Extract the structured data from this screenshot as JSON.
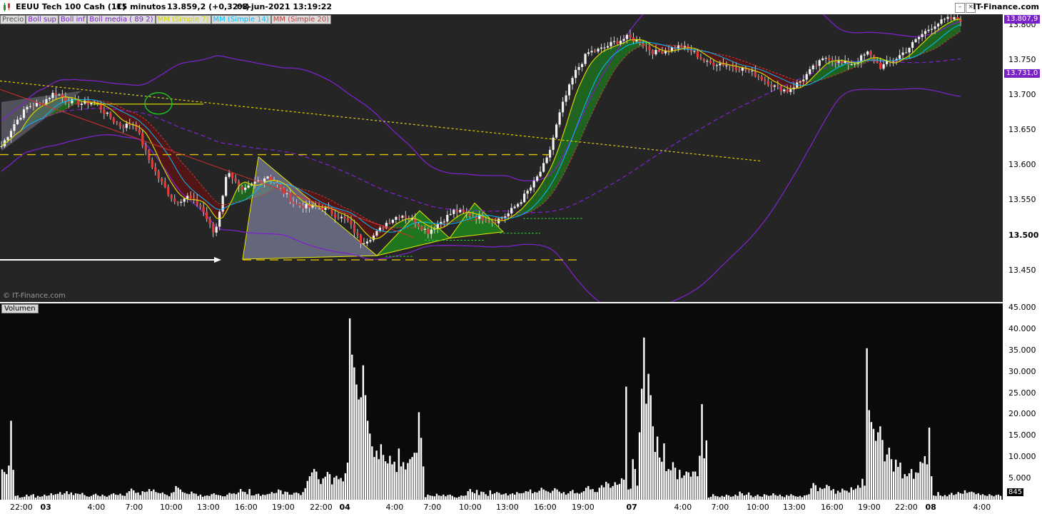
{
  "header": {
    "instrument": "EEUU Tech 100 Cash (1€)",
    "timeframe": "15 minutos",
    "price": "13.859,2 (+0,32%)",
    "datetime": "08-jun-2021 13:19:22",
    "brand": "IT-Finance.com"
  },
  "legend": [
    {
      "label": "Precio",
      "color": "#555555"
    },
    {
      "label": "Boll sup",
      "color": "#7b22c7"
    },
    {
      "label": "Boll inf",
      "color": "#7b22c7"
    },
    {
      "label": "Boll media ( 89 2)",
      "color": "#7b22c7"
    },
    {
      "label": "MM (Simple 7)",
      "color": "#d6d600"
    },
    {
      "label": "MM (Simple 14)",
      "color": "#00bfff"
    },
    {
      "label": "MM (Simple 20)",
      "color": "#c04040"
    }
  ],
  "watermark": "© IT-Finance.com",
  "volume_label": "Volumen",
  "volume_current": "845",
  "price_tags": [
    {
      "value": "13.807,9",
      "color": "#7b22c7"
    },
    {
      "value": "13.731,0",
      "color": "#7b22c7"
    }
  ],
  "chart_data": [
    {
      "type": "candlestick",
      "title": "EEUU Tech 100 Cash (1€)",
      "xlabel": "",
      "ylabel": "",
      "ylim": [
        13405,
        13815
      ],
      "y_ticks": [
        "13.450",
        "13.500",
        "13.550",
        "13.600",
        "13.650",
        "13.700",
        "13.750",
        "13.800"
      ],
      "x_ticks": [
        {
          "label": "22:00",
          "bold": false
        },
        {
          "label": "03",
          "bold": true
        },
        {
          "label": "4:00",
          "bold": false
        },
        {
          "label": "7:00",
          "bold": false
        },
        {
          "label": "10:00",
          "bold": false
        },
        {
          "label": "13:00",
          "bold": false
        },
        {
          "label": "16:00",
          "bold": false
        },
        {
          "label": "19:00",
          "bold": false
        },
        {
          "label": "22:00",
          "bold": false
        },
        {
          "label": "04",
          "bold": true
        },
        {
          "label": "4:00",
          "bold": false
        },
        {
          "label": "7:00",
          "bold": false
        },
        {
          "label": "10:00",
          "bold": false
        },
        {
          "label": "13:00",
          "bold": false
        },
        {
          "label": "16:00",
          "bold": false
        },
        {
          "label": "19:00",
          "bold": false
        },
        {
          "label": "07",
          "bold": true
        },
        {
          "label": "4:00",
          "bold": false
        },
        {
          "label": "7:00",
          "bold": false
        },
        {
          "label": "10:00",
          "bold": false
        },
        {
          "label": "13:00",
          "bold": false
        },
        {
          "label": "16:00",
          "bold": false
        },
        {
          "label": "19:00",
          "bold": false
        },
        {
          "label": "22:00",
          "bold": false
        },
        {
          "label": "08",
          "bold": true
        },
        {
          "label": "4:00",
          "bold": false
        }
      ],
      "close_path": [
        13627,
        13660,
        13684,
        13688,
        13704,
        13692,
        13688,
        13690,
        13670,
        13655,
        13660,
        13610,
        13575,
        13548,
        13555,
        13540,
        13500,
        13595,
        13560,
        13575,
        13585,
        13565,
        13545,
        13540,
        13540,
        13530,
        13520,
        13490,
        13500,
        13520,
        13530,
        13520,
        13505,
        13520,
        13535,
        13530,
        13525,
        13520,
        13530,
        13550,
        13575,
        13610,
        13680,
        13730,
        13760,
        13765,
        13775,
        13782,
        13775,
        13760,
        13765,
        13770,
        13760,
        13745,
        13745,
        13740,
        13735,
        13725,
        13712,
        13706,
        13720,
        13740,
        13755,
        13745,
        13745,
        13760,
        13740,
        13750,
        13765,
        13785,
        13800,
        13808,
        13808
      ]
    },
    {
      "type": "bar",
      "title": "Volumen",
      "ylim": [
        0,
        46000
      ],
      "y_ticks": [
        "5.000",
        "10.000",
        "15.000",
        "20.000",
        "25.000",
        "30.000",
        "35.000",
        "40.000",
        "45.000"
      ],
      "values": [
        7100,
        6500,
        6000,
        8000,
        18500,
        7000,
        900,
        1000,
        500,
        600,
        700,
        1200,
        800,
        1100,
        1300,
        500,
        900,
        700,
        800,
        1200,
        900,
        1000,
        1500,
        1100,
        1300,
        1400,
        1800,
        1200,
        1500,
        2000,
        1300,
        1700,
        1100,
        1500,
        1400,
        1300,
        1600,
        1100,
        800,
        700,
        900,
        1200,
        1400,
        1000,
        800,
        1200,
        900,
        700,
        1000,
        1300,
        1500,
        1200,
        1100,
        1400,
        1000,
        900,
        1600,
        2000,
        2600,
        2200,
        1600,
        1700,
        1100,
        2000,
        1800,
        1900,
        2500,
        2000,
        2400,
        1800,
        1600,
        1500,
        1700,
        1300,
        1100,
        800,
        1600,
        1800,
        3200,
        2800,
        2400,
        1800,
        1600,
        1400,
        1300,
        1900,
        1500,
        1400,
        900,
        1200,
        700,
        900,
        1000,
        900,
        1300,
        1500,
        1200,
        1100,
        1000,
        800,
        800,
        1200,
        1600,
        1400,
        1500,
        1300,
        1700,
        2500,
        1900,
        1800,
        1300,
        2500,
        1000,
        1000,
        1300,
        1400,
        900,
        1200,
        1100,
        1300,
        1400,
        1800,
        1500,
        1600,
        2400,
        2200,
        1300,
        1900,
        1800,
        1200,
        1200,
        1600,
        1700,
        1500,
        1100,
        1800,
        2700,
        4400,
        5500,
        6400,
        7200,
        6600,
        4800,
        3700,
        5000,
        5400,
        6500,
        6000,
        3600,
        5200,
        5600,
        4800,
        5100,
        4300,
        6200,
        8700,
        42500,
        34000,
        31000,
        27000,
        23500,
        24000,
        31500,
        24500,
        18500,
        15500,
        12500,
        10000,
        11500,
        9500,
        13000,
        10500,
        9000,
        8500,
        10300,
        8300,
        8900,
        6500,
        12000,
        7800,
        8800,
        7100,
        8600,
        9500,
        10000,
        11000,
        11000,
        20500,
        14500,
        7800,
        600,
        1200,
        1000,
        900,
        800,
        1400,
        1000,
        900,
        1200,
        800,
        1100,
        1200,
        900,
        600,
        500,
        700,
        1000,
        900,
        1000,
        2000,
        2500,
        1800,
        1500,
        2300,
        1100,
        1900,
        1800,
        1300,
        900,
        2200,
        1300,
        1500,
        1800,
        1600,
        1200,
        1300,
        1500,
        1000,
        1300,
        1500,
        1200,
        1800,
        1500,
        1500,
        1600,
        2000,
        1900,
        2400,
        1500,
        1800,
        1700,
        2100,
        2800,
        2400,
        2100,
        1900,
        1600,
        2100,
        2700,
        2400,
        1900,
        1500,
        1800,
        1200,
        1500,
        2000,
        2300,
        1500,
        1600,
        1400,
        1700,
        2000,
        2800,
        3200,
        2400,
        2500,
        1800,
        1800,
        2800,
        3400,
        2900,
        4200,
        3800,
        2800,
        3200,
        4100,
        3500,
        3700,
        5000,
        4700,
        26500,
        2400,
        2600,
        9500,
        7200,
        3300,
        15800,
        26000,
        38000,
        22500,
        29500,
        24500,
        17200,
        11200,
        14800,
        9900,
        8900,
        13200,
        6700,
        7200,
        6900,
        8800,
        7500,
        4800,
        7000,
        5100,
        5700,
        6600,
        6400,
        5400,
        6600,
        6600,
        5500,
        10300,
        22400,
        9700,
        13900,
        500,
        700,
        1300,
        900,
        800,
        600,
        900,
        700,
        1200,
        1000,
        700,
        800,
        1200,
        900,
        1900,
        1500,
        1000,
        1200,
        1700,
        1000,
        600,
        900,
        1200,
        800,
        700,
        1300,
        1100,
        900,
        1000,
        1500,
        1100,
        900,
        1200,
        800,
        600,
        1100,
        900,
        1300,
        1000,
        800,
        700,
        900,
        600,
        1000,
        1100,
        1300,
        2700,
        3900,
        3400,
        2000,
        2800,
        2500,
        2700,
        3500,
        3200,
        2200,
        2500,
        1400,
        2100,
        1700,
        2600,
        2200,
        2100,
        1700,
        2900,
        2300,
        2600,
        3400,
        2800,
        4900,
        3300,
        35500,
        21000,
        18200,
        16600,
        13800,
        15800,
        17200,
        14000,
        9000,
        10600,
        12200,
        9500,
        6600,
        9400,
        7700,
        8700,
        5000,
        6000,
        5500,
        6200,
        7200,
        4900,
        6400,
        6300,
        8900,
        8600,
        10200,
        8300,
        16900,
        5500,
        1000,
        900,
        1800,
        1000,
        800,
        1100,
        800,
        1200,
        1600,
        1100,
        1300,
        1800,
        1500,
        1400,
        2200,
        1600,
        1800,
        1900,
        1700,
        1300,
        1500,
        1100,
        1300,
        1000,
        900,
        1300,
        1000,
        800,
        1100,
        1200,
        900
      ]
    }
  ]
}
